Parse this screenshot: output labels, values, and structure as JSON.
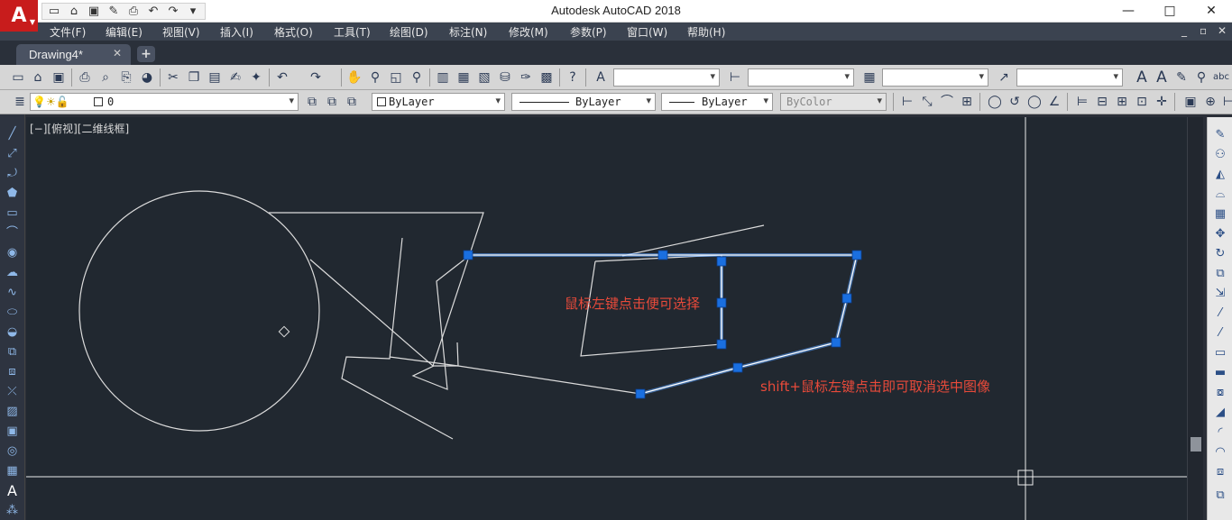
{
  "app": {
    "title": "Autodesk AutoCAD 2018",
    "logo_letter": "A",
    "colors": {
      "brand_red": "#c81c1c",
      "canvas": "#212830",
      "selection_blue": "#1a6fe0",
      "annotation_red": "#e84a3a"
    }
  },
  "quick_access": {
    "icons": [
      "new-file-icon",
      "open-file-icon",
      "save-icon",
      "save-as-icon",
      "print-icon",
      "undo-icon",
      "redo-icon",
      "customize-dropdown-icon"
    ]
  },
  "window_controls": {
    "minimize": "—",
    "maximize": "□",
    "close": "✕"
  },
  "menu": {
    "items": [
      "文件(F)",
      "编辑(E)",
      "视图(V)",
      "插入(I)",
      "格式(O)",
      "工具(T)",
      "绘图(D)",
      "标注(N)",
      "修改(M)",
      "参数(P)",
      "窗口(W)",
      "帮助(H)"
    ],
    "doc_controls": [
      "_",
      "▫",
      "✕"
    ]
  },
  "tabs": {
    "active": {
      "label": "Drawing4*",
      "close": "✕"
    },
    "new_tab": "+"
  },
  "properties_bar": {
    "layer": "0",
    "color": "ByLayer",
    "linetype": "ByLayer",
    "lineweight": "ByLayer",
    "plotstyle": "ByColor"
  },
  "viewport": {
    "label": "[−][俯视][二维线框]"
  },
  "annotations": {
    "select_hint": "鼠标左键点击便可选择",
    "deselect_hint": "shift+鼠标左键点击即可取消选中图像"
  },
  "icons": {
    "toolbar1": [
      "qnew-icon",
      "open-icon",
      "save-icon",
      "print-icon",
      "plot-preview-icon",
      "publish-icon",
      "3d-print-icon",
      "cut-icon",
      "copy-icon",
      "paste-icon",
      "match-properties-icon",
      "block-editor-icon",
      "undo-icon",
      "redo-icon",
      "pan-icon",
      "zoom-realtime-icon",
      "zoom-window-icon",
      "zoom-previous-icon",
      "properties-icon",
      "design-center-icon",
      "tool-palettes-icon",
      "sheet-set-icon",
      "markup-icon",
      "calculator-icon",
      "help-icon",
      "text-style-icon",
      "dim-style-icon",
      "table-style-icon",
      "multileader-style-icon",
      "annotation-scale-icon",
      "annotation-visibility-icon",
      "auto-scale-icon"
    ],
    "toolbar2_layer": [
      "layer-properties-icon",
      "bulb-icon",
      "sun-icon",
      "lock-icon",
      "make-current-icon",
      "layer-previous-icon",
      "layer-state-icon"
    ],
    "dimension_tools": [
      "linear-dim-icon",
      "aligned-dim-icon",
      "arc-length-icon",
      "ordinate-icon",
      "radius-icon",
      "jogged-icon",
      "diameter-icon",
      "angular-icon",
      "quick-dim-icon",
      "baseline-icon",
      "continue-icon",
      "tolerance-icon"
    ],
    "draw_tools": [
      "line-icon",
      "construction-line-icon",
      "polyline-icon",
      "polygon-icon",
      "rectangle-icon",
      "arc-icon",
      "circle-icon",
      "revision-cloud-icon",
      "spline-icon",
      "ellipse-icon",
      "ellipse-arc-icon",
      "insert-block-icon",
      "make-block-icon",
      "point-icon",
      "hatch-icon",
      "gradient-icon",
      "region-icon",
      "table-icon",
      "mtext-icon",
      "add-selected-icon"
    ],
    "modify_tools": [
      "erase-icon",
      "copy-object-icon",
      "mirror-icon",
      "offset-icon",
      "array-icon",
      "move-icon",
      "rotate-icon",
      "scale-icon",
      "stretch-icon",
      "trim-icon",
      "extend-icon",
      "break-at-point-icon",
      "break-icon",
      "join-icon",
      "chamfer-icon",
      "fillet-icon",
      "blend-icon",
      "explode-icon"
    ]
  }
}
